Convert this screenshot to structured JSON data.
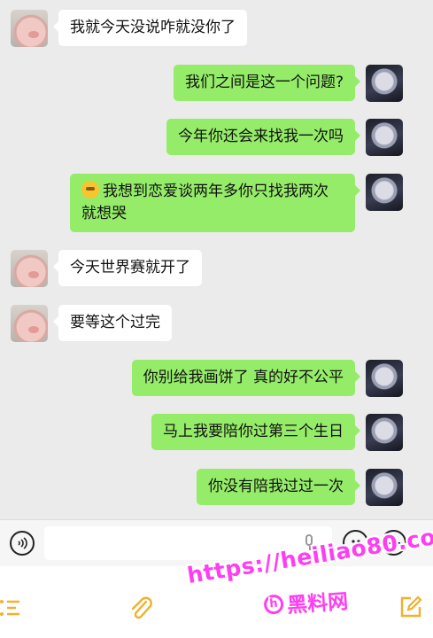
{
  "messages": [
    {
      "side": "left",
      "avatar": "pig-avatar",
      "text": "我就今天没说咋就没你了"
    },
    {
      "side": "right",
      "avatar": "anime-avatar",
      "text": "我们之间是这一个问题?"
    },
    {
      "side": "right",
      "avatar": "anime-avatar",
      "text": "今年你还会来找我一次吗"
    },
    {
      "side": "right",
      "avatar": "anime-avatar",
      "emoji": "nervous-smile-emoji",
      "line1": "我想到恋爱谈两年多你只找我两次",
      "line2": "就想哭"
    },
    {
      "side": "left",
      "avatar": "pig-avatar",
      "text": "今天世界赛就开了"
    },
    {
      "side": "left",
      "avatar": "pig-avatar",
      "text": "要等这个过完"
    },
    {
      "side": "right",
      "avatar": "anime-avatar",
      "text": "你别给我画饼了 真的好不公平"
    },
    {
      "side": "right",
      "avatar": "anime-avatar",
      "text": "马上我要陪你过第三个生日"
    },
    {
      "side": "right",
      "avatar": "anime-avatar",
      "text": "你没有陪我过过一次"
    }
  ],
  "input_bar": {
    "voice_icon": "voice-icon",
    "text_value": "",
    "mic_icon": "microphone-icon",
    "emoji_icon": "emoji-icon",
    "plus_icon": "plus-icon"
  },
  "bottom_bar": {
    "icons": [
      "list-icon",
      "paperclip-icon",
      "edit-icon"
    ]
  },
  "watermark": {
    "url": "https://heiliao80.com",
    "brand": "黑料网",
    "brand_mark": "h"
  },
  "colors": {
    "sent_bubble": "#95ec69",
    "received_bubble": "#ffffff",
    "chat_background": "#ebebeb",
    "watermark": "#ff3df2",
    "bottom_icons": "#f2b02c"
  }
}
